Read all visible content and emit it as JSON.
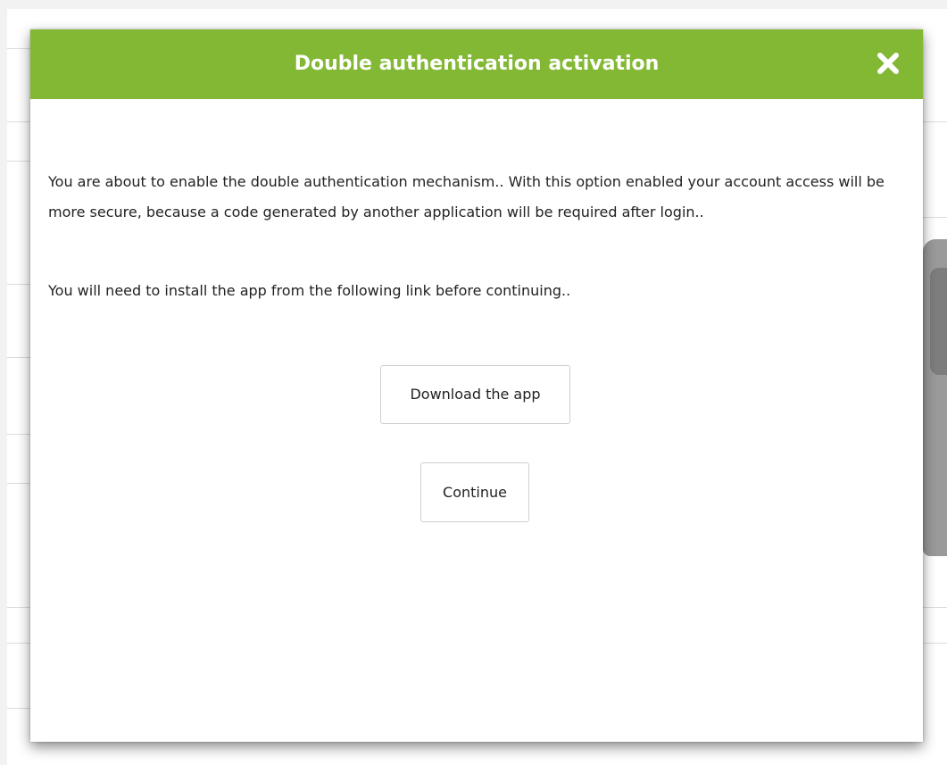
{
  "modal": {
    "title": "Double authentication activation",
    "close_icon": "close-icon",
    "header_color": "#83b834",
    "paragraph_1": "You are about to enable the double authentication mechanism.. With this option enabled your account access will be more secure, because a code generated by another application will be required after login..",
    "paragraph_2": "You will need to install the app from the following link before continuing..",
    "download_button_label": "Download the app",
    "continue_button_label": "Continue"
  }
}
